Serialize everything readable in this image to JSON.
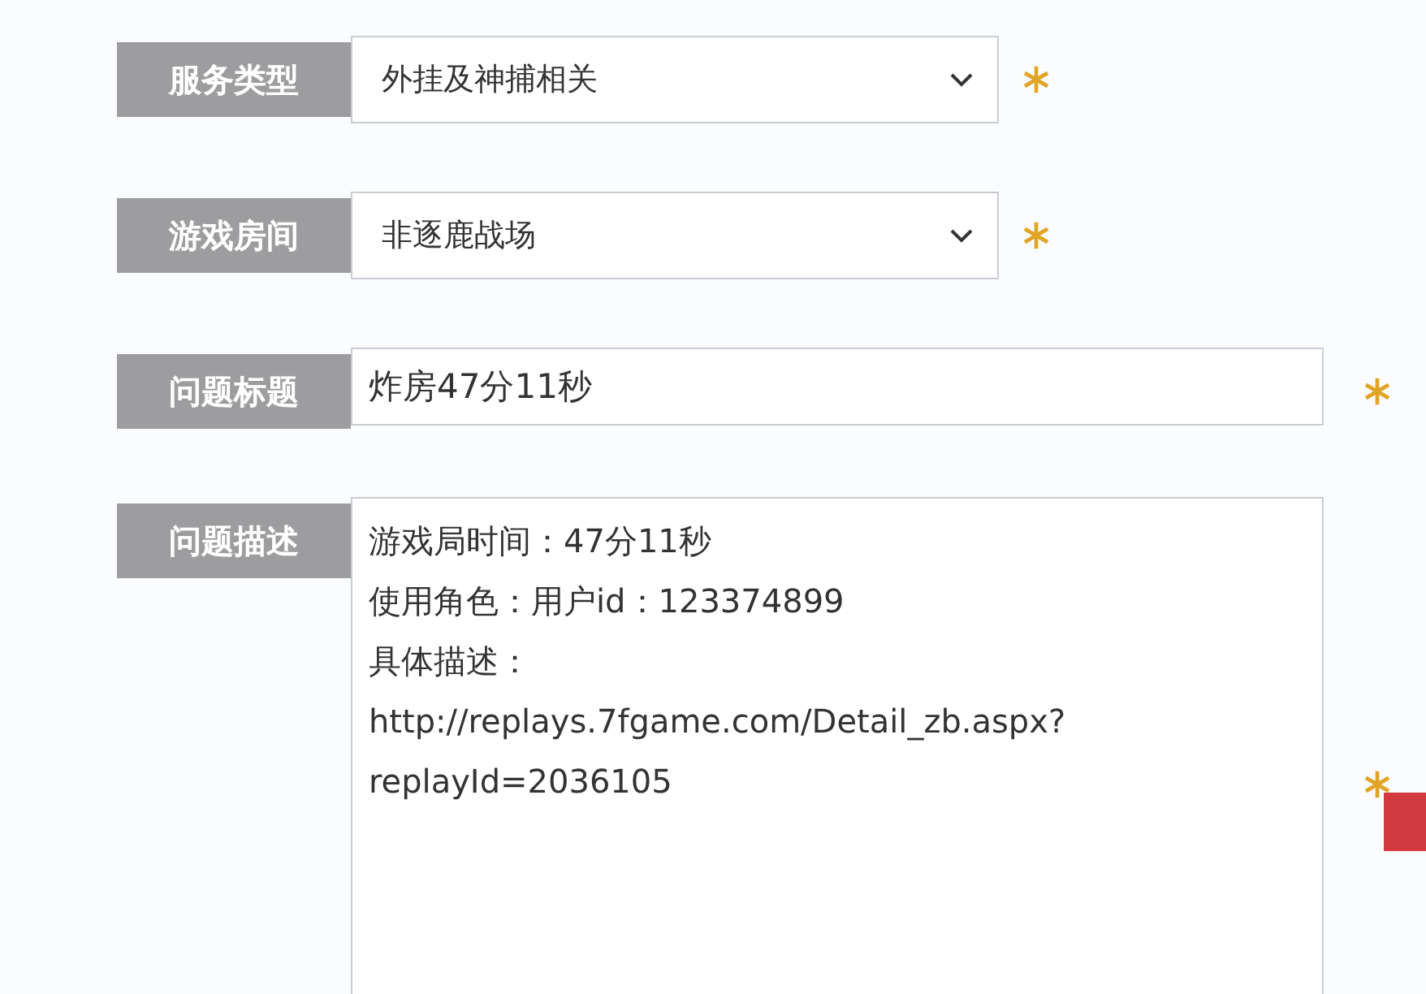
{
  "fields": [
    {
      "kind": "select",
      "label": "服务类型",
      "value": "外挂及神捕相关",
      "required": true
    },
    {
      "kind": "select",
      "label": "游戏房间",
      "value": "非逐鹿战场",
      "required": true
    },
    {
      "kind": "text",
      "label": "问题标题",
      "value": "炸房47分11秒",
      "required": true
    },
    {
      "kind": "textarea",
      "label": "问题描述",
      "lines": [
        "游戏局时间：47分11秒",
        "使用角色：用户id：123374899",
        "具体描述：",
        "http://replays.7fgame.com/Detail_zb.aspx?",
        "replayId=2036105"
      ],
      "required": true
    }
  ]
}
